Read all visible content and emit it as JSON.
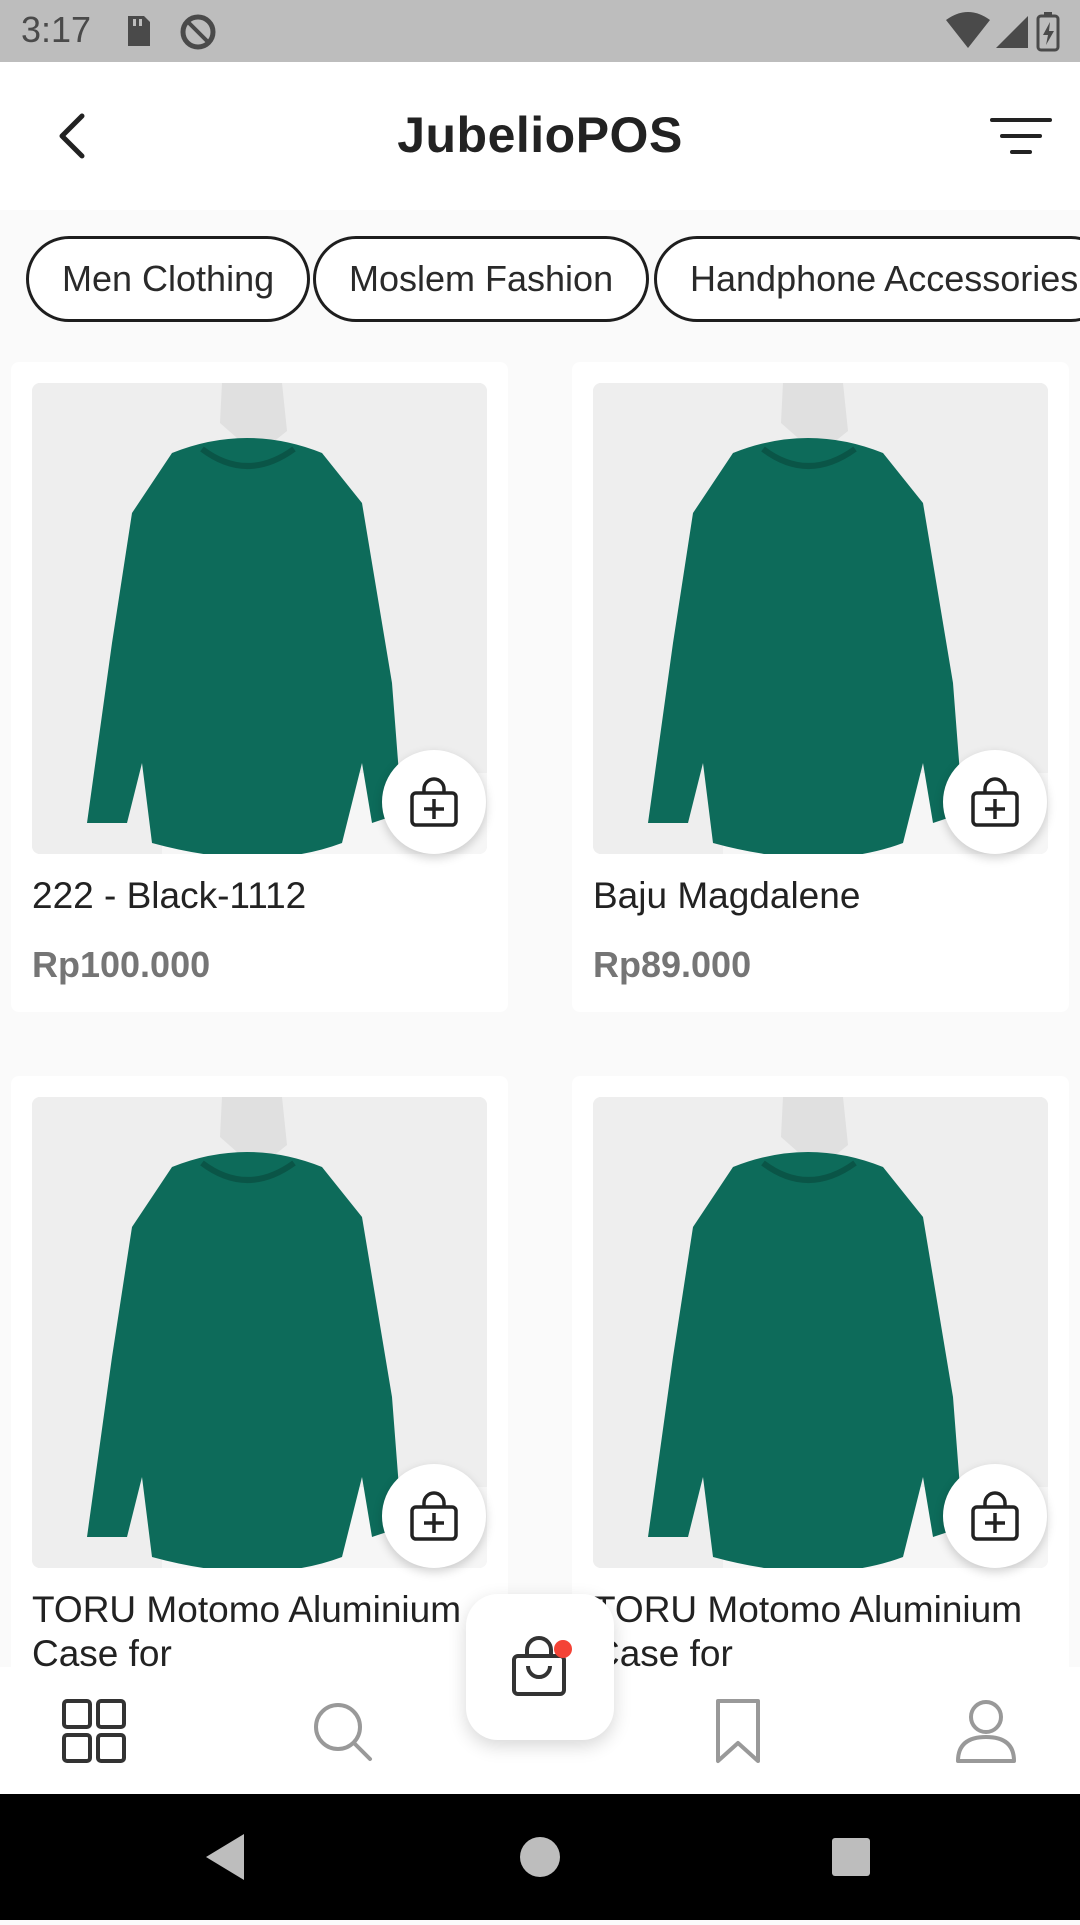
{
  "status_bar": {
    "time": "3:17",
    "left_icons": [
      "sd-card-icon",
      "data-saver-icon"
    ],
    "right_icons": [
      "wifi-icon",
      "signal-icon",
      "battery-icon"
    ]
  },
  "header": {
    "title": "JubelioPOS",
    "back_icon": "back-arrow-icon",
    "filter_icon": "filter-icon"
  },
  "categories": [
    {
      "label": "Men Clothing"
    },
    {
      "label": "Moslem Fashion"
    },
    {
      "label": "Handphone Accessories"
    }
  ],
  "products": [
    {
      "name": "222 - Black-1112",
      "price": "Rp100.000"
    },
    {
      "name": "Baju Magdalene",
      "price": "Rp89.000"
    },
    {
      "name": "TORU Motomo Aluminium Case for",
      "price": ""
    },
    {
      "name": "TORU Motomo Aluminium Case for",
      "price": ""
    }
  ],
  "bottom_nav": {
    "items": [
      "grid-icon",
      "search-icon",
      "cart-icon",
      "bookmark-icon",
      "profile-icon"
    ]
  },
  "colors": {
    "sweater": "#0d6b5a",
    "cart_badge": "#f44336",
    "accent_text": "#222222",
    "price_text": "#757575"
  }
}
